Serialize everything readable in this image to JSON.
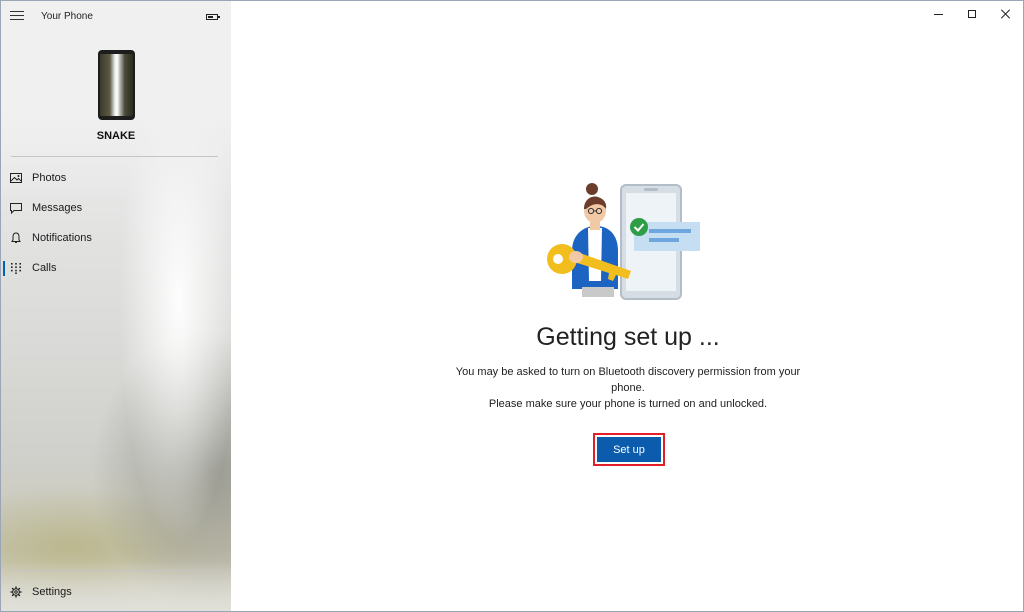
{
  "app": {
    "title": "Your Phone"
  },
  "device": {
    "name": "SNAKE"
  },
  "sidebar": {
    "items": [
      {
        "label": "Photos",
        "icon": "photos-icon"
      },
      {
        "label": "Messages",
        "icon": "messages-icon"
      },
      {
        "label": "Notifications",
        "icon": "bell-icon"
      },
      {
        "label": "Calls",
        "icon": "dialpad-icon",
        "active": true
      }
    ],
    "settings_label": "Settings"
  },
  "main": {
    "heading": "Getting set up ...",
    "description_line1": "You may be asked to turn on Bluetooth discovery permission from your phone.",
    "description_line2": "Please make sure your phone is turned on and unlocked.",
    "setup_button": "Set up"
  },
  "colors": {
    "accent": "#0b5cad",
    "highlight": "#e21f26"
  }
}
